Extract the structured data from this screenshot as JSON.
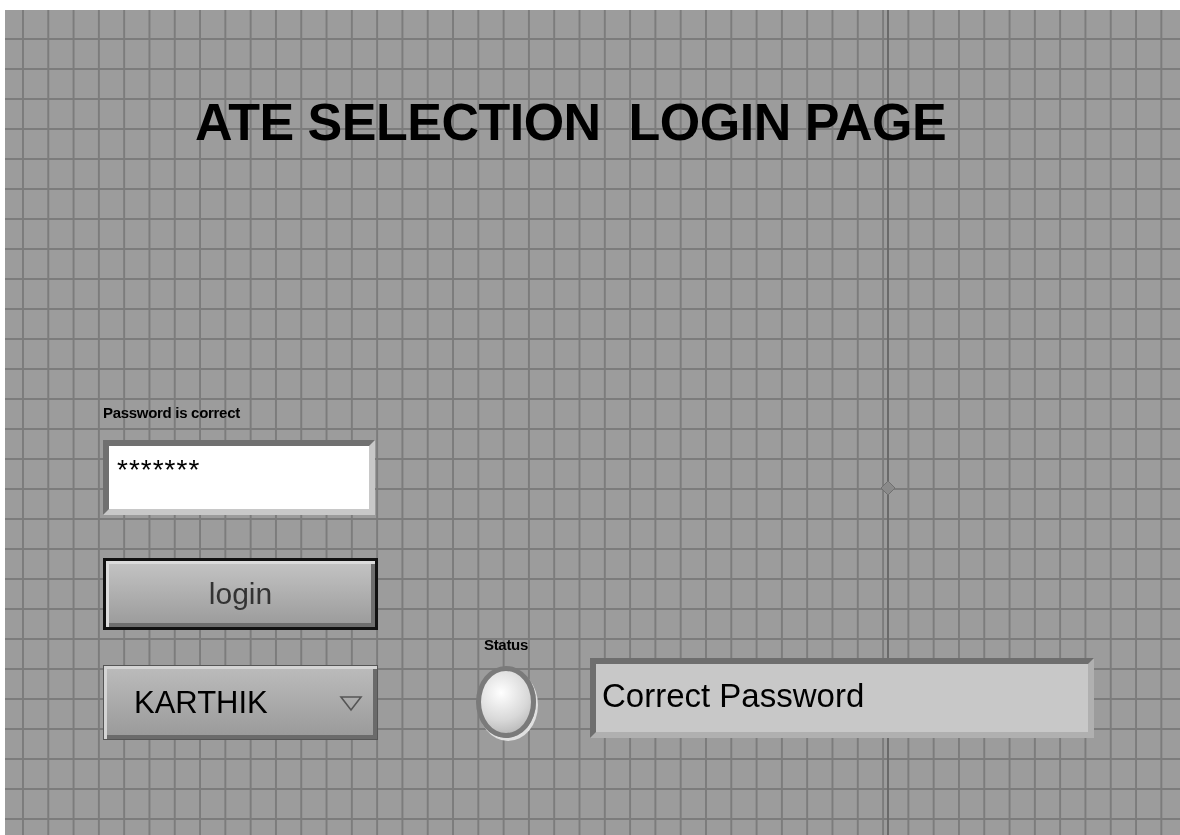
{
  "title": "ATE SELECTION  LOGIN PAGE",
  "password": {
    "label": "Password is correct",
    "value": "*******"
  },
  "login_button": {
    "label": "login"
  },
  "user_dropdown": {
    "value": "KARTHIK"
  },
  "status": {
    "label": "Status",
    "on": true
  },
  "message": {
    "value": "Correct Password"
  }
}
